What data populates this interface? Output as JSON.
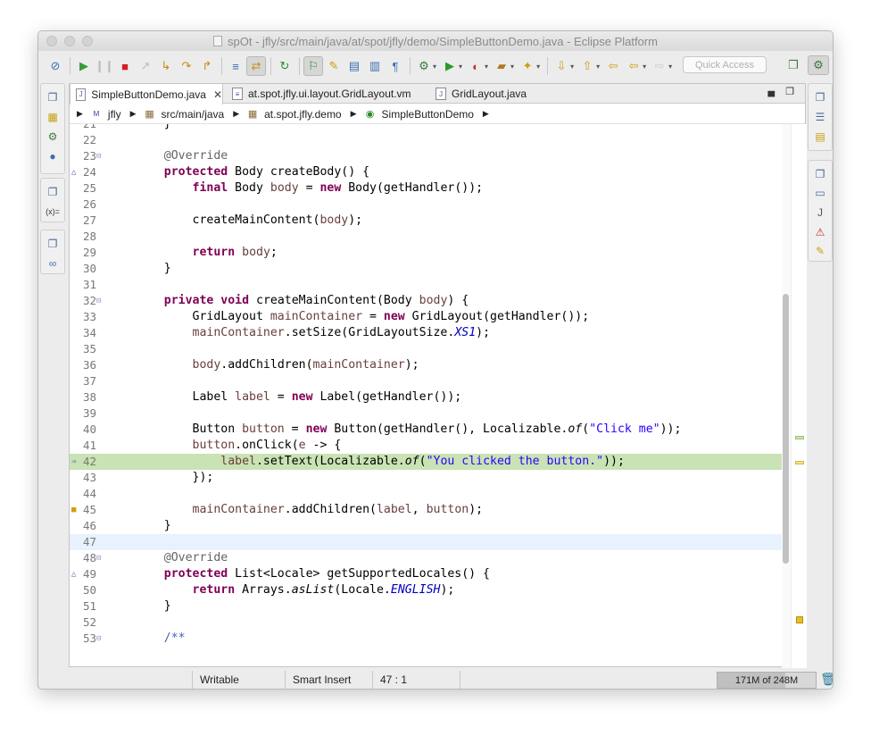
{
  "window": {
    "title": "spOt - jfly/src/main/java/at/spot/jfly/demo/SimpleButtonDemo.java - Eclipse Platform"
  },
  "toolbar": {
    "quick_access_placeholder": "Quick Access"
  },
  "tabs": [
    {
      "label": "SimpleButtonDemo.java",
      "active": true
    },
    {
      "label": "at.spot.jfly.ui.layout.GridLayout.vm",
      "active": false
    },
    {
      "label": "GridLayout.java",
      "active": false
    }
  ],
  "breadcrumb": [
    "jfly",
    "src/main/java",
    "at.spot.jfly.demo",
    "SimpleButtonDemo"
  ],
  "code": {
    "highlighted_line": "42",
    "current_line": "47",
    "lines": [
      {
        "n": "21",
        "text": "    }"
      },
      {
        "n": "22",
        "text": ""
      },
      {
        "n": "23",
        "text": "    @Override"
      },
      {
        "n": "24",
        "text": "    protected Body createBody() {"
      },
      {
        "n": "25",
        "text": "        final Body body = new Body(getHandler());"
      },
      {
        "n": "26",
        "text": ""
      },
      {
        "n": "27",
        "text": "        createMainContent(body);"
      },
      {
        "n": "28",
        "text": ""
      },
      {
        "n": "29",
        "text": "        return body;"
      },
      {
        "n": "30",
        "text": "    }"
      },
      {
        "n": "31",
        "text": ""
      },
      {
        "n": "32",
        "text": "    private void createMainContent(Body body) {"
      },
      {
        "n": "33",
        "text": "        GridLayout mainContainer = new GridLayout(getHandler());"
      },
      {
        "n": "34",
        "text": "        mainContainer.setSize(GridLayoutSize.XS1);"
      },
      {
        "n": "35",
        "text": ""
      },
      {
        "n": "36",
        "text": "        body.addChildren(mainContainer);"
      },
      {
        "n": "37",
        "text": ""
      },
      {
        "n": "38",
        "text": "        Label label = new Label(getHandler());"
      },
      {
        "n": "39",
        "text": ""
      },
      {
        "n": "40",
        "text": "        Button button = new Button(getHandler(), Localizable.of(\"Click me\"));"
      },
      {
        "n": "41",
        "text": "        button.onClick(e -> {"
      },
      {
        "n": "42",
        "text": "            label.setText(Localizable.of(\"You clicked the button.\"));"
      },
      {
        "n": "43",
        "text": "        });"
      },
      {
        "n": "44",
        "text": ""
      },
      {
        "n": "45",
        "text": "        mainContainer.addChildren(label, button);"
      },
      {
        "n": "46",
        "text": "    }"
      },
      {
        "n": "47",
        "text": ""
      },
      {
        "n": "48",
        "text": "    @Override"
      },
      {
        "n": "49",
        "text": "    protected List<Locale> getSupportedLocales() {"
      },
      {
        "n": "50",
        "text": "        return Arrays.asList(Locale.ENGLISH);"
      },
      {
        "n": "51",
        "text": "    }"
      },
      {
        "n": "52",
        "text": ""
      },
      {
        "n": "53",
        "text": "    /**"
      }
    ]
  },
  "status": {
    "writable": "Writable",
    "insert_mode": "Smart Insert",
    "position": "47 : 1",
    "heap": "171M of 248M",
    "heap_fraction": 0.69
  },
  "colors": {
    "keyword": "#7f0055",
    "string": "#2a00ff",
    "annotation": "#646464",
    "field": "#0000c0",
    "highlight": "#c9e3b4",
    "current_line": "#e8f2fe"
  }
}
